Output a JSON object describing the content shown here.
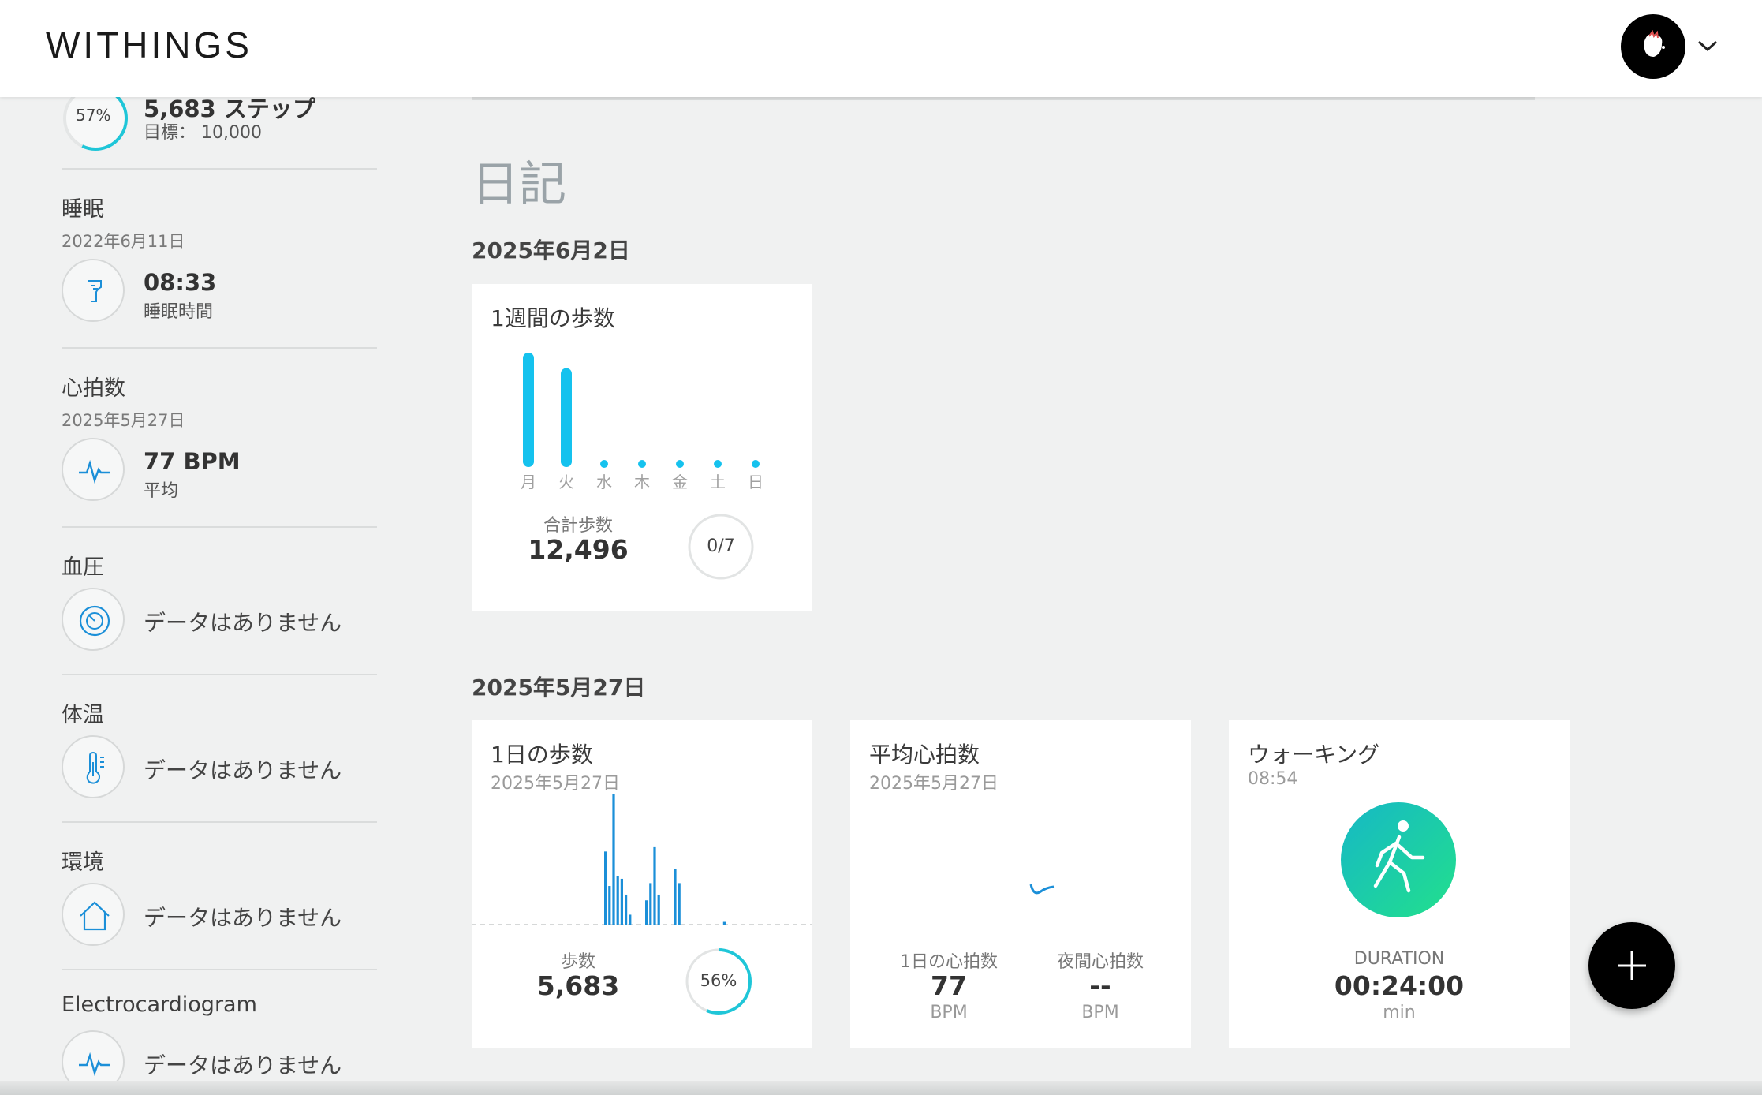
{
  "header": {
    "logo": "WITHINGS"
  },
  "sidebar": {
    "steps": {
      "percent": "57%",
      "progress": 0.57,
      "value": "5,683 ステップ",
      "goal": "目標： 10,000"
    },
    "sleep": {
      "title": "睡眠",
      "date": "2022年6月11日",
      "value": "08:33",
      "sub": "睡眠時間"
    },
    "heart": {
      "title": "心拍数",
      "date": "2025年5月27日",
      "value": "77 BPM",
      "sub": "平均"
    },
    "bp": {
      "title": "血圧",
      "nodata": "データはありません"
    },
    "temp": {
      "title": "体温",
      "nodata": "データはありません"
    },
    "env": {
      "title": "環境",
      "nodata": "データはありません"
    },
    "ecg": {
      "title": "Electrocardiogram",
      "nodata": "データはありません"
    }
  },
  "main": {
    "title": "日記",
    "day1": {
      "date": "2025年6月2日",
      "weekly_steps": {
        "title": "1週間の歩数",
        "total_label": "合計歩数",
        "total_value": "12,496",
        "goal_days": "0/7"
      }
    },
    "day2": {
      "date": "2025年5月27日",
      "daily_steps": {
        "title": "1日の歩数",
        "date": "2025年5月27日",
        "steps_label": "歩数",
        "steps_value": "5,683",
        "percent": "56%",
        "progress": 0.56
      },
      "avg_hr": {
        "title": "平均心拍数",
        "date": "2025年5月27日",
        "day_label": "1日の心拍数",
        "day_value": "77",
        "day_unit": "BPM",
        "night_label": "夜間心拍数",
        "night_value": "--",
        "night_unit": "BPM"
      },
      "walking": {
        "title": "ウォーキング",
        "time": "08:54",
        "duration_label": "DURATION",
        "duration_value": "00:24:00",
        "duration_unit": "min"
      }
    }
  },
  "chart_data": [
    {
      "type": "bar",
      "categories": [
        "月",
        "火",
        "水",
        "木",
        "金",
        "土",
        "日"
      ],
      "values": [
        6700,
        5796,
        0,
        0,
        0,
        0,
        0
      ]
    },
    {
      "type": "bar",
      "values": [
        0,
        0,
        0,
        0,
        0,
        0,
        0,
        0,
        0,
        0,
        0,
        0,
        0,
        0,
        0,
        0,
        0,
        0,
        0,
        0,
        0,
        0,
        0,
        0,
        0,
        0,
        0,
        0,
        0,
        0,
        0,
        0,
        0,
        0,
        0,
        0,
        0,
        0,
        0,
        0,
        0,
        0,
        0,
        0,
        0,
        0,
        0,
        0,
        0,
        0,
        0,
        0,
        0,
        0,
        0,
        0,
        0,
        0,
        0,
        0,
        0,
        0,
        0,
        0,
        0,
        0,
        0,
        0,
        0,
        0,
        0,
        0,
        0,
        0,
        0,
        0,
        0,
        0,
        0,
        0,
        0,
        0,
        0,
        0,
        0,
        0,
        0,
        0,
        0,
        0,
        0,
        0,
        0,
        0,
        0,
        0,
        0,
        0,
        0,
        0,
        0,
        0,
        0,
        0,
        0,
        0,
        0,
        0,
        0,
        0,
        0,
        0,
        0,
        0,
        0,
        0,
        0,
        0,
        0,
        0,
        0,
        0,
        0,
        0,
        0,
        0,
        0,
        0,
        0,
        0,
        0,
        0,
        0,
        0,
        0,
        0,
        0,
        0,
        0,
        0,
        0,
        0,
        0,
        0
      ]
    }
  ],
  "daily_bars": [
    52,
    28,
    92,
    35,
    33,
    22,
    8,
    0,
    0,
    0,
    18,
    30,
    55,
    22,
    0,
    0,
    0,
    40,
    30,
    0,
    0,
    0,
    0,
    0,
    0,
    0,
    0,
    0,
    0,
    3
  ],
  "colors": {
    "accent": "#15c2ee",
    "bar_daily": "#1b8fd8",
    "walk_from": "#16b8c6",
    "walk_to": "#22e08c"
  }
}
